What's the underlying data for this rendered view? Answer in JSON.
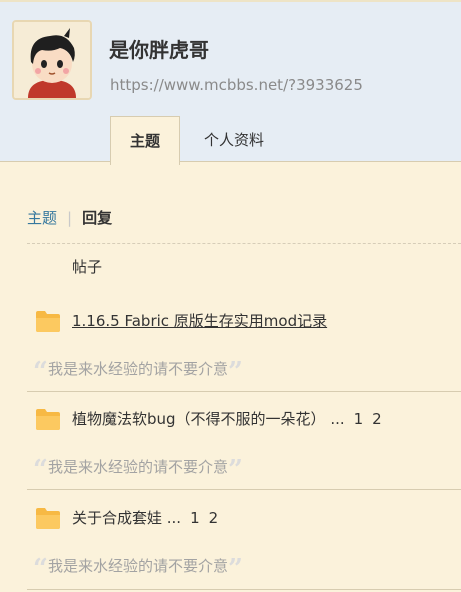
{
  "profile": {
    "username": "是你胖虎哥",
    "url": "https://www.mcbbs.net/?3933625"
  },
  "tabs": [
    {
      "label": "主题",
      "active": true
    },
    {
      "label": "个人资料",
      "active": false
    }
  ],
  "subnav": {
    "topics": "主题",
    "separator": "|",
    "replies": "回复"
  },
  "list_header": "帖子",
  "threads": [
    {
      "title": "1.16.5 Fabric 原版生存实用mod记录",
      "pages": [],
      "quote": "我是来水经验的请不要介意"
    },
    {
      "title": "植物魔法软bug（不得不服的一朵花） ...",
      "pages": [
        "1",
        "2"
      ],
      "quote": "我是来水经验的请不要介意"
    },
    {
      "title": "关于合成套娃 ...",
      "pages": [
        "1",
        "2"
      ],
      "quote": "我是来水经验的请不要介意"
    }
  ],
  "quote_marks": {
    "open": "“",
    "close": "”"
  },
  "colors": {
    "link": "#36789e",
    "background": "#fbf2db",
    "header_bg": "#e6edf4",
    "folder": "#f7b944"
  }
}
